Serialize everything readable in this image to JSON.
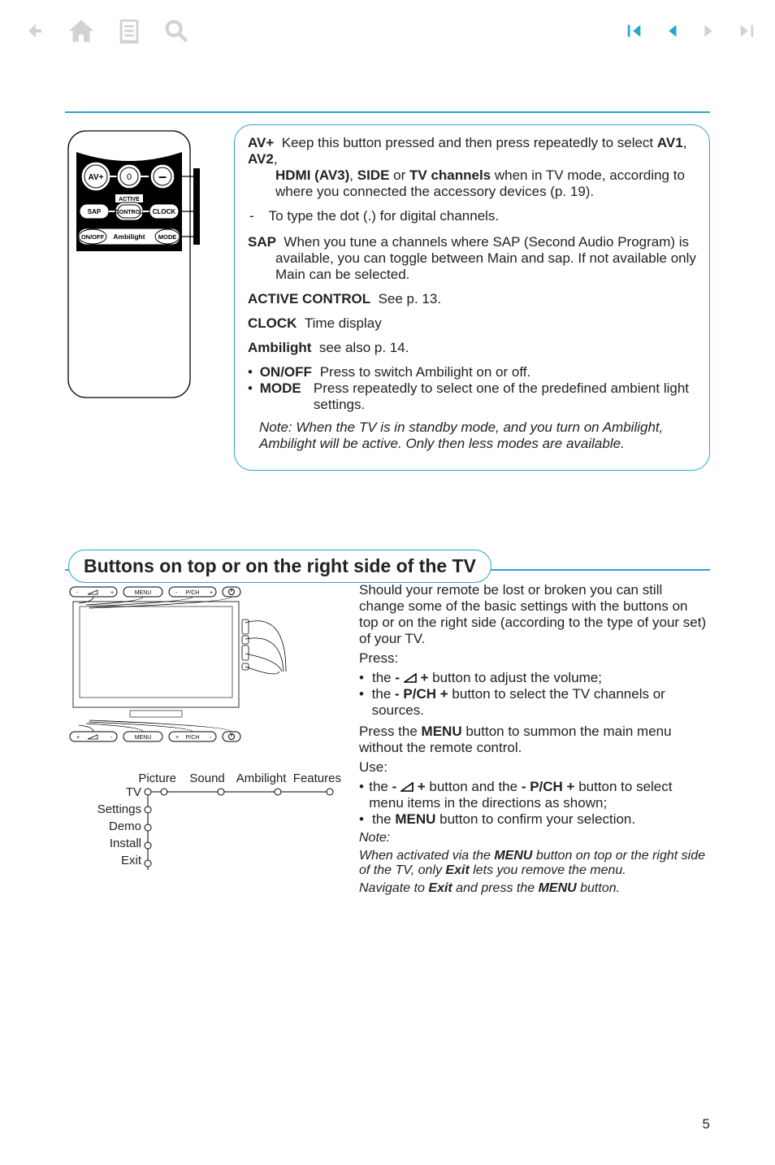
{
  "remote": {
    "btn_av": "AV+",
    "btn_zero": "0",
    "btn_minus": "–",
    "label_active": "ACTIVE",
    "btn_sap": "SAP",
    "btn_control": "CONTROL",
    "btn_clock": "CLOCK",
    "btn_onoff": "ON/OFF",
    "btn_ambilight": "Ambilight",
    "btn_mode": "MODE"
  },
  "defs": {
    "av_label": "AV+",
    "av_body1": "Keep this button pressed and then press repeatedly to select ",
    "av_b_av1": "AV1",
    "av_b_av2": "AV2",
    "av_b_hdmi": "HDMI (AV3)",
    "av_b_side": "SIDE",
    "av_b_tv": "TV channels",
    "av_body2": " when in TV mode, according to where you connected the accessory devices (p. 19).",
    "dash": "-",
    "dash_body": "To type the dot (.) for digital channels.",
    "sap_label": "SAP",
    "sap_body": "When you tune a channels where SAP (Second Audio Program) is available, you can toggle between Main and sap. If not available only Main can be selected.",
    "active_label": "ACTIVE CONTROL",
    "active_body": "See p. 13.",
    "clock_label": "CLOCK",
    "clock_body": "Time display",
    "amb_label": "Ambilight",
    "amb_body": "see also p. 14.",
    "onoff_label": "ON/OFF",
    "onoff_body": "Press to switch Ambilight on or off.",
    "mode_label": "MODE",
    "mode_body": "Press repeatedly to select one of the predefined ambient light settings.",
    "note": "Note: When the TV is in standby mode, and you turn on Ambilight, Ambilight will be active. Only then less modes are available."
  },
  "section2": {
    "heading": "Buttons on top or on the right side of the TV",
    "tv_top": {
      "menu": "MENU",
      "pch": "P/CH"
    },
    "tree": {
      "cols": [
        "Picture",
        "Sound",
        "Ambilight",
        "Features"
      ],
      "rows": [
        "TV",
        "Settings",
        "Demo",
        "Install",
        "Exit"
      ]
    },
    "para1": "Should your remote be lost or broken you can still change some of the basic settings with the buttons on top or on the right side (according to the type of your set) of your TV.",
    "press": "Press:",
    "li1a": "the ",
    "li1b": " button to adjust the volume;",
    "li2a": "the ",
    "li2_bold": "- P/CH +",
    "li2b": " button to select the TV channels or sources.",
    "para2a": "Press the ",
    "para2_bold": "MENU",
    "para2b": " button to summon the main menu without the remote control.",
    "use": "Use:",
    "li3a": "the ",
    "li3b": " button and the ",
    "li3_bold2": "- P/CH +",
    "li3c": " button to select menu items in the directions as shown;",
    "li4a": "the ",
    "li4_bold": "MENU",
    "li4b": " button to confirm your selection.",
    "note_label": "Note:",
    "note1a": "When activated via the ",
    "note1_b1": "MENU",
    "note1b": " button on top or the right side of the TV, only ",
    "note1_b2": "Exit",
    "note1c": " lets you remove the menu.",
    "note2a": "Navigate to ",
    "note2_b1": "Exit",
    "note2b": " and press the ",
    "note2_b2": "MENU",
    "note2c": " button."
  },
  "page_number": "5"
}
